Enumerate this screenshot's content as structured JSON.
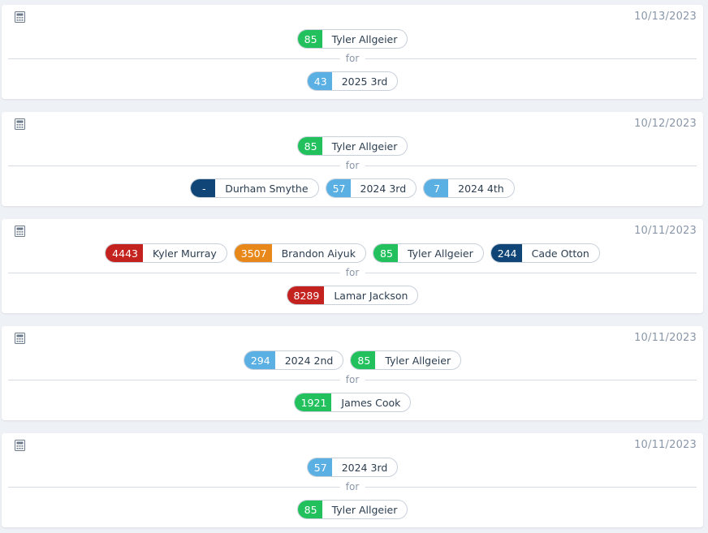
{
  "colors": {
    "green": "#22c15e",
    "light_blue": "#5aafe3",
    "navy": "#0f4677",
    "red": "#c3221f",
    "orange": "#e8881a"
  },
  "for_label": "for",
  "trades": [
    {
      "date": "10/13/2023",
      "gives": [
        {
          "rank": "85",
          "name": "Tyler Allgeier",
          "color": "#22c15e"
        }
      ],
      "receives": [
        {
          "rank": "43",
          "name": "2025 3rd",
          "color": "#5aafe3"
        }
      ]
    },
    {
      "date": "10/12/2023",
      "gives": [
        {
          "rank": "85",
          "name": "Tyler Allgeier",
          "color": "#22c15e"
        }
      ],
      "receives": [
        {
          "rank": "-",
          "name": "Durham Smythe",
          "color": "#0f4677"
        },
        {
          "rank": "57",
          "name": "2024 3rd",
          "color": "#5aafe3"
        },
        {
          "rank": "7",
          "name": "2024 4th",
          "color": "#5aafe3"
        }
      ]
    },
    {
      "date": "10/11/2023",
      "gives": [
        {
          "rank": "4443",
          "name": "Kyler Murray",
          "color": "#c3221f"
        },
        {
          "rank": "3507",
          "name": "Brandon Aiyuk",
          "color": "#e8881a"
        },
        {
          "rank": "85",
          "name": "Tyler Allgeier",
          "color": "#22c15e"
        },
        {
          "rank": "244",
          "name": "Cade Otton",
          "color": "#0f4677"
        }
      ],
      "receives": [
        {
          "rank": "8289",
          "name": "Lamar Jackson",
          "color": "#c3221f"
        }
      ]
    },
    {
      "date": "10/11/2023",
      "gives": [
        {
          "rank": "294",
          "name": "2024 2nd",
          "color": "#5aafe3"
        },
        {
          "rank": "85",
          "name": "Tyler Allgeier",
          "color": "#22c15e"
        }
      ],
      "receives": [
        {
          "rank": "1921",
          "name": "James Cook",
          "color": "#22c15e"
        }
      ]
    },
    {
      "date": "10/11/2023",
      "gives": [
        {
          "rank": "57",
          "name": "2024 3rd",
          "color": "#5aafe3"
        }
      ],
      "receives": [
        {
          "rank": "85",
          "name": "Tyler Allgeier",
          "color": "#22c15e"
        }
      ]
    }
  ]
}
